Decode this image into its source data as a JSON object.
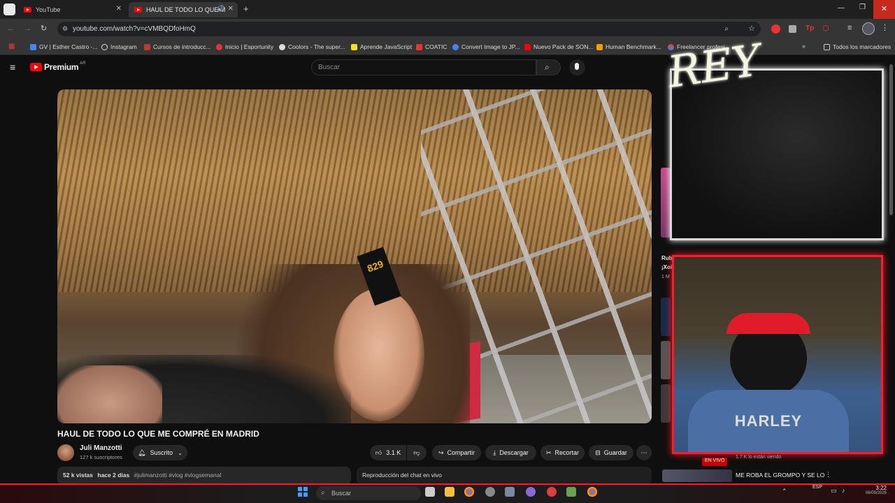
{
  "browser": {
    "tabs": [
      {
        "title": "YouTube",
        "active": false
      },
      {
        "title": "HAUL DE TODO LO QUE M",
        "active": true
      }
    ],
    "url": "youtube.com/watch?v=cVMBQDfoHmQ",
    "bookmarks": [
      "GV | Esther Castro -...",
      "Instagram",
      "Cursos de introducc...",
      "Inicio | Esportunity",
      "Coolors - The super...",
      "Aprende JavaScript",
      "COATIC",
      "Convert Image to JP...",
      "Nuevo Pack de SON...",
      "Human Benchmark...",
      "Freelancer profesi...",
      "Todos los marcadores"
    ]
  },
  "youtube": {
    "logo_text": "Premium",
    "logo_region": "AR",
    "search_placeholder": "Buscar",
    "video_title": "HAUL DE TODO LO QUE ME COMPRÉ EN MADRID",
    "channel_name": "Juli Manzotti",
    "subscribers": "127 k suscriptores",
    "subscribed_label": "Suscrito",
    "likes": "3.1 K",
    "share_label": "Compartir",
    "download_label": "Descargar",
    "clip_label": "Recortar",
    "save_label": "Guardar",
    "views": "52 k vistas",
    "published": "hace 2 días",
    "hashtags": "#julimanzotti #vlog #vlogsemanal",
    "live_chat_label": "Reproducción del chat en vivo",
    "sign_text": "829",
    "sidebar_fragments": [
      "Rub",
      "¡Xoi",
      "1 M"
    ]
  },
  "overlay": {
    "logo_text": "REY",
    "shirt_text": "HARLEY",
    "live_badge": "EN VIVO",
    "live_viewers": "1.7 K lo están viendo",
    "recommended_title": "ME ROBA EL GROMPO Y SE LO"
  },
  "taskbar": {
    "search_placeholder": "Buscar",
    "language": "ESP",
    "time": "3:22",
    "date": "06/09/2025"
  },
  "colors": {
    "accent_red": "#ff1a2a",
    "youtube_red": "#ff0000",
    "bg": "#0f0f0f"
  }
}
